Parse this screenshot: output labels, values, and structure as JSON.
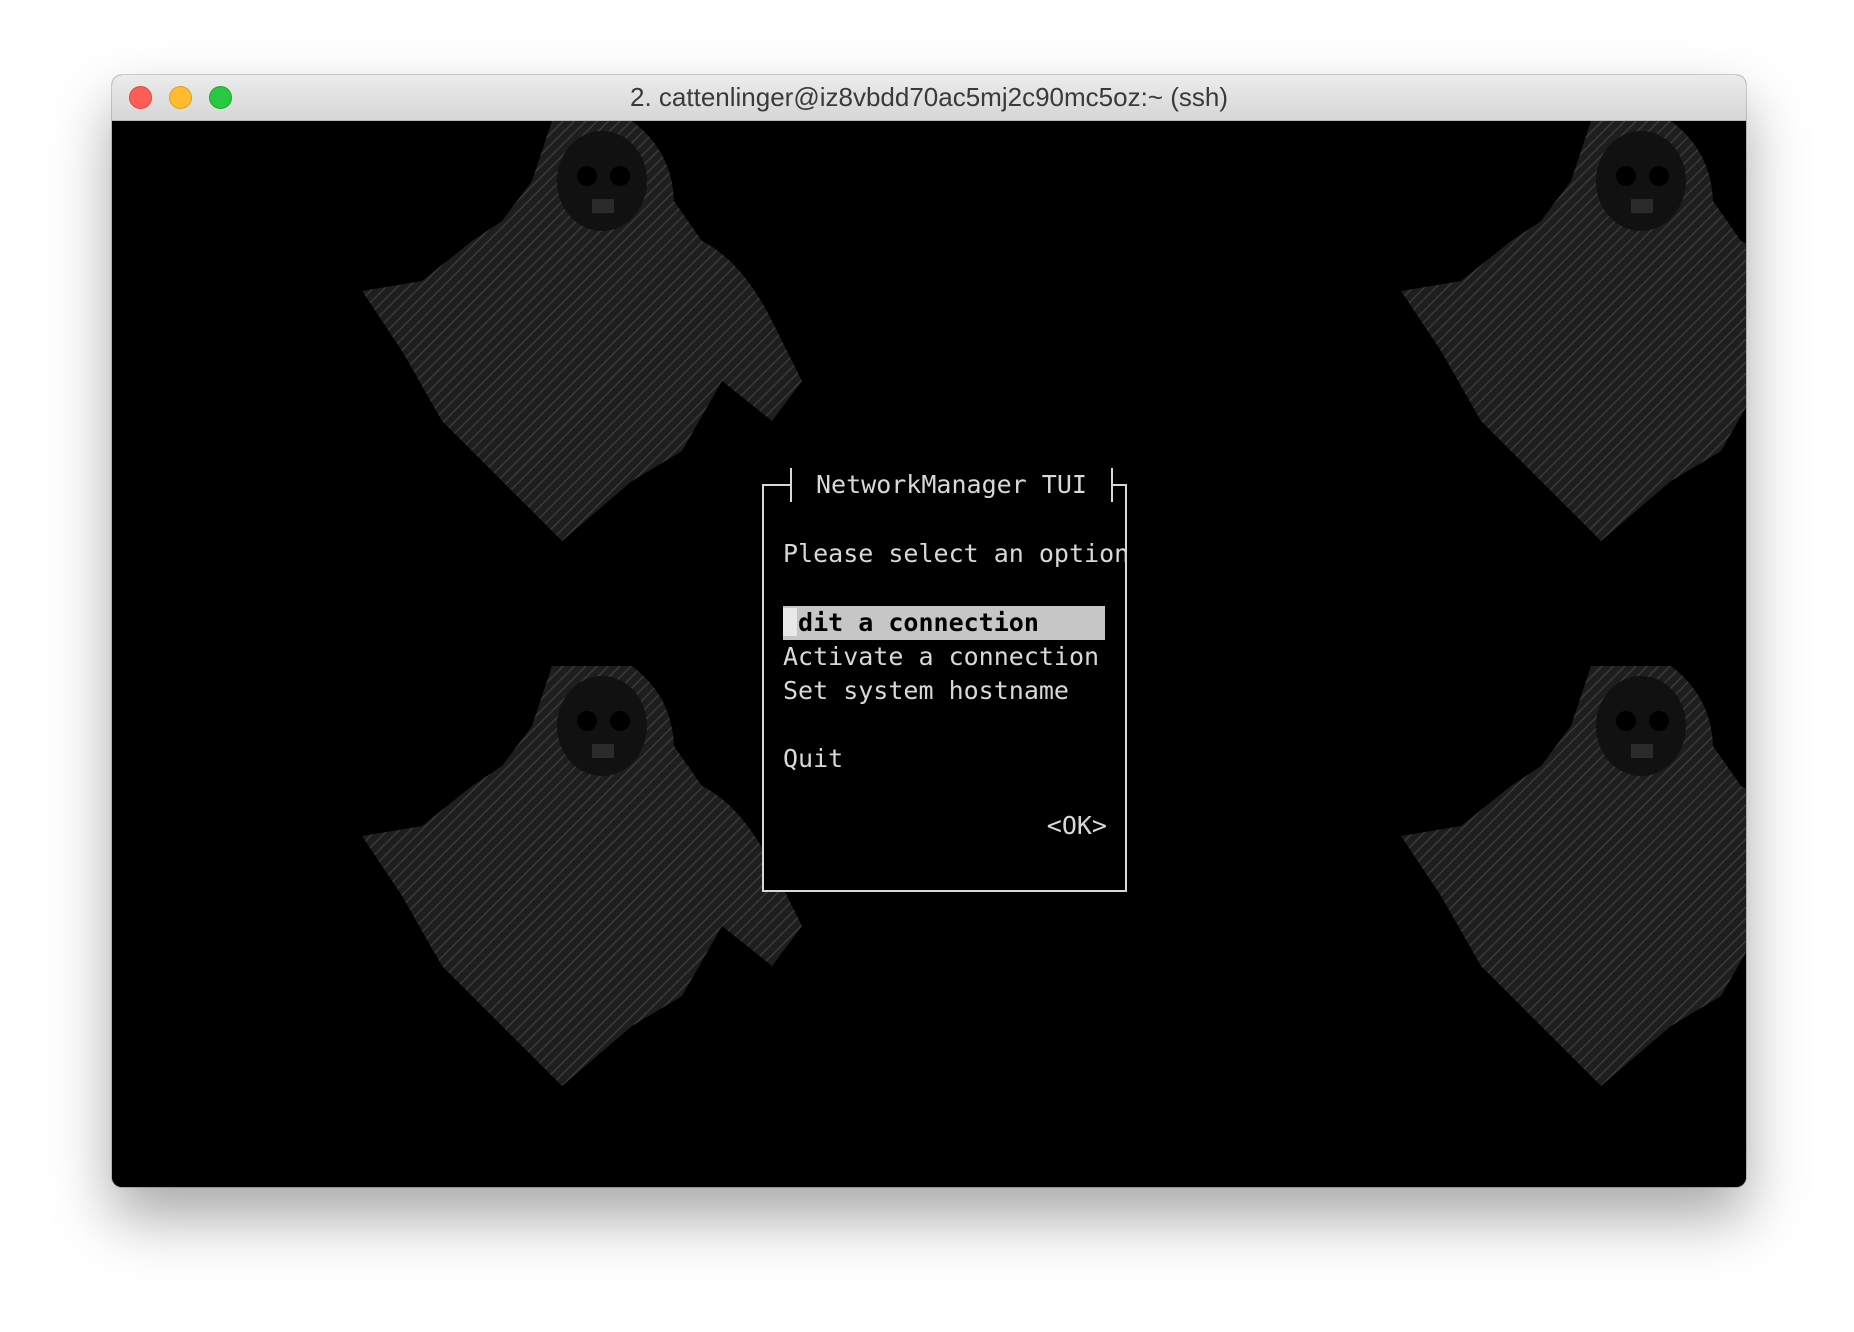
{
  "window": {
    "title": "2. cattenlinger@iz8vbdd70ac5mj2c90mc5oz:~ (ssh)",
    "controls": {
      "close": "close",
      "minimize": "minimize",
      "zoom": "zoom"
    }
  },
  "dialog": {
    "title": "NetworkManager TUI",
    "prompt": "Please select an option",
    "menu": {
      "edit": "Edit a connection",
      "activate": "Activate a connection",
      "hostname": "Set system hostname",
      "quit": "Quit"
    },
    "selected_item": "Edit a connection",
    "ok_label": "<OK>"
  },
  "colors": {
    "terminal_bg": "#000000",
    "text": "#d8d8d8",
    "selection_bg": "#c6c6c6",
    "wallpaper_art": "#2e2e2e"
  },
  "icons": {
    "wallpaper": "hooded-skull-figure-ascii-art"
  }
}
